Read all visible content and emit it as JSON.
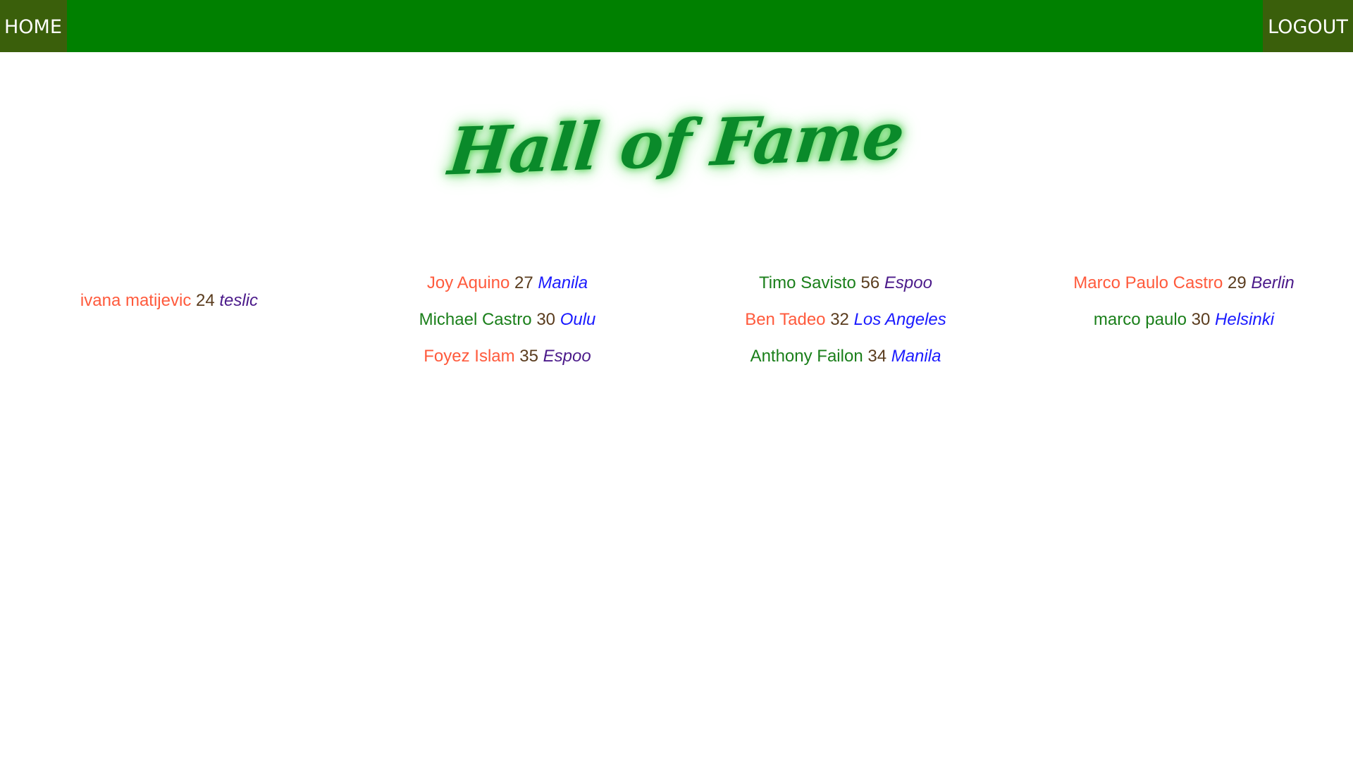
{
  "nav": {
    "home_label": "HOME",
    "logout_label": "LOGOUT"
  },
  "page_title": "Hall of Fame",
  "columns": [
    {
      "entries": [
        {
          "name": "ivana matijevic",
          "age": "24",
          "city": "teslic",
          "name_color": "red",
          "city_color": "purple"
        }
      ]
    },
    {
      "entries": [
        {
          "name": "Joy Aquino",
          "age": "27",
          "city": "Manila",
          "name_color": "red",
          "city_color": "blue"
        },
        {
          "name": "Michael Castro",
          "age": "30",
          "city": "Oulu",
          "name_color": "green",
          "city_color": "blue"
        },
        {
          "name": "Foyez Islam",
          "age": "35",
          "city": "Espoo",
          "name_color": "red",
          "city_color": "purple"
        }
      ]
    },
    {
      "entries": [
        {
          "name": "Timo Savisto",
          "age": "56",
          "city": "Espoo",
          "name_color": "green",
          "city_color": "purple"
        },
        {
          "name": "Ben Tadeo",
          "age": "32",
          "city": "Los Angeles",
          "name_color": "red",
          "city_color": "blue"
        },
        {
          "name": "Anthony Failon",
          "age": "34",
          "city": "Manila",
          "name_color": "green",
          "city_color": "blue"
        }
      ]
    },
    {
      "entries": [
        {
          "name": "Marco Paulo Castro",
          "age": "29",
          "city": "Berlin",
          "name_color": "red",
          "city_color": "purple"
        },
        {
          "name": "marco paulo",
          "age": "30",
          "city": "Helsinki",
          "name_color": "green",
          "city_color": "blue"
        }
      ]
    }
  ],
  "colors": {
    "navbar": "#008000",
    "nav_button": "#3a5f0b",
    "title": "#0a8a2a",
    "name_red": "#ff5a3c",
    "name_green": "#1a7f1a",
    "age": "#5a3c1e",
    "city_purple": "#4b1a8a",
    "city_blue": "#1a1aff"
  }
}
